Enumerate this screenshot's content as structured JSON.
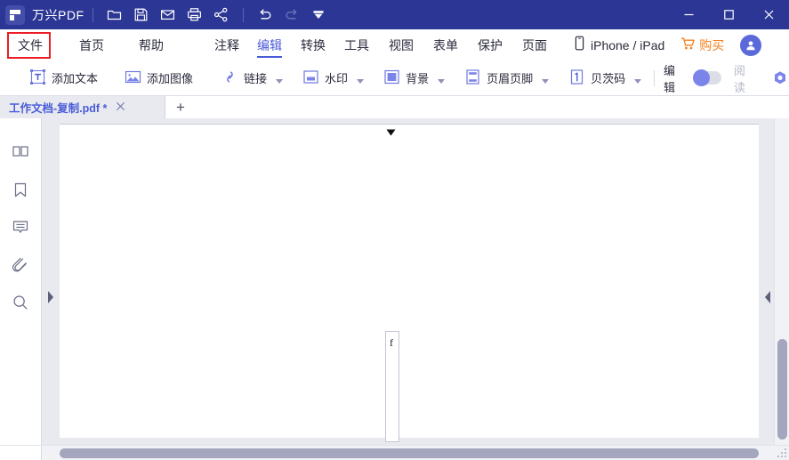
{
  "titlebar": {
    "brand": "万兴PDF",
    "logo_icon": "wondershare-pdf-logo-icon",
    "quick_actions": [
      {
        "name": "open-folder-icon",
        "title": "打开"
      },
      {
        "name": "save-icon",
        "title": "保存"
      },
      {
        "name": "email-icon",
        "title": "邮件"
      },
      {
        "name": "print-icon",
        "title": "打印"
      },
      {
        "name": "share-icon",
        "title": "分享"
      },
      {
        "name": "undo-icon",
        "title": "撤销"
      },
      {
        "name": "redo-icon",
        "title": "重做"
      },
      {
        "name": "customize-dropdown-icon",
        "title": "更多"
      }
    ],
    "window_controls": {
      "minimize": "minimize-icon",
      "maximize": "maximize-icon",
      "close": "close-icon"
    }
  },
  "menubar": {
    "items": [
      {
        "label": "文件",
        "active": false,
        "highlighted": true
      },
      {
        "label": "首页",
        "active": false,
        "highlighted": false
      },
      {
        "label": "帮助",
        "active": false,
        "highlighted": false
      },
      {
        "label": "注释",
        "active": false,
        "highlighted": false
      },
      {
        "label": "编辑",
        "active": true,
        "highlighted": false
      },
      {
        "label": "转换",
        "active": false,
        "highlighted": false
      },
      {
        "label": "工具",
        "active": false,
        "highlighted": false
      },
      {
        "label": "视图",
        "active": false,
        "highlighted": false
      },
      {
        "label": "表单",
        "active": false,
        "highlighted": false
      },
      {
        "label": "保护",
        "active": false,
        "highlighted": false
      },
      {
        "label": "页面",
        "active": false,
        "highlighted": false
      }
    ],
    "iphone_label": "iPhone / iPad",
    "iphone_icon": "phone-icon",
    "buy_label": "购买",
    "buy_icon": "cart-icon",
    "account_icon": "user-avatar-icon",
    "highlight_color": "#ec1c24",
    "accent_color": "#4a5bd8"
  },
  "ribbon": {
    "items": [
      {
        "label": "添加文本",
        "icon": "add-text-icon",
        "caret": false
      },
      {
        "label": "添加图像",
        "icon": "add-image-icon",
        "caret": false
      },
      {
        "label": "链接",
        "icon": "link-icon",
        "caret": true
      },
      {
        "label": "水印",
        "icon": "watermark-icon",
        "caret": true
      },
      {
        "label": "背景",
        "icon": "background-icon",
        "caret": true
      },
      {
        "label": "页眉页脚",
        "icon": "header-footer-icon",
        "caret": true
      },
      {
        "label": "贝茨码",
        "icon": "bates-numbering-icon",
        "caret": true
      }
    ],
    "mode_toggle": {
      "edit_label": "编辑",
      "read_label": "阅读",
      "state": "edit"
    },
    "settings_icon": "settings-gear-icon"
  },
  "tabbar": {
    "tabs": [
      {
        "label": "工作文档-复制.pdf *",
        "close_icon": "close-tab-icon",
        "active": true
      }
    ],
    "new_tab_label": "+"
  },
  "rail": {
    "items": [
      {
        "name": "thumbnails-panel-icon",
        "title": "页面缩略图"
      },
      {
        "name": "bookmarks-panel-icon",
        "title": "书签"
      },
      {
        "name": "comments-panel-icon",
        "title": "注释"
      },
      {
        "name": "attachments-panel-icon",
        "title": "附件"
      },
      {
        "name": "search-panel-icon",
        "title": "搜索"
      }
    ]
  },
  "workspace": {
    "expand_panel_icon": "expand-left-panel-icon",
    "collapse_panel_icon": "collapse-right-panel-icon",
    "page_top_marker_icon": "page-top-marker-icon",
    "textbox": {
      "content": "f"
    },
    "vertical_scrollbar": "vertical-scrollbar",
    "horizontal_scrollbar": "horizontal-scrollbar",
    "resize_grip_icon": "resize-grip-icon"
  },
  "colors": {
    "titlebar_bg": "#2c3795",
    "accent": "#4a5bd8",
    "workspace_bg": "#e9eaf0",
    "page_bg": "#ffffff",
    "orange": "#f5801f",
    "red_highlight": "#ec1c24"
  }
}
